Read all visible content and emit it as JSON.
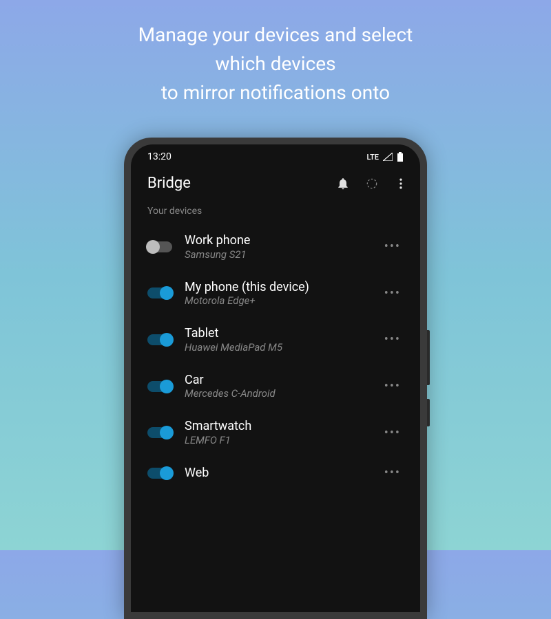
{
  "promo": {
    "line1": "Manage your devices and select",
    "line2": "which devices",
    "line3": "to mirror notifications onto"
  },
  "statusBar": {
    "time": "13:20",
    "network": "LTE"
  },
  "appBar": {
    "title": "Bridge"
  },
  "section": {
    "header": "Your devices"
  },
  "devices": [
    {
      "name": "Work phone",
      "model": "Samsung S21",
      "enabled": false
    },
    {
      "name": "My phone (this device)",
      "model": "Motorola Edge+",
      "enabled": true
    },
    {
      "name": "Tablet",
      "model": "Huawei MediaPad M5",
      "enabled": true
    },
    {
      "name": "Car",
      "model": "Mercedes C-Android",
      "enabled": true
    },
    {
      "name": "Smartwatch",
      "model": "LEMFO F1",
      "enabled": true
    },
    {
      "name": "Web",
      "model": "",
      "enabled": true
    }
  ],
  "moreGlyph": "•••"
}
